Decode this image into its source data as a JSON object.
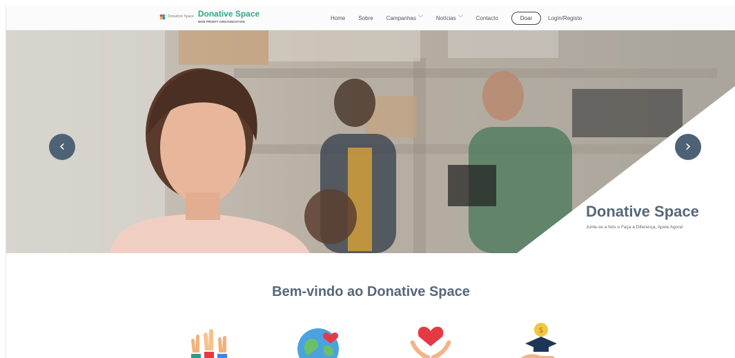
{
  "brand": {
    "small_text": "Donative Space",
    "title": "Donative Space",
    "subtitle": "NON PROFIT ORGANIZATION"
  },
  "nav": {
    "items": [
      {
        "label": "Home",
        "dropdown": false
      },
      {
        "label": "Sobre",
        "dropdown": false
      },
      {
        "label": "Campanhas",
        "dropdown": true
      },
      {
        "label": "Notícias",
        "dropdown": true
      },
      {
        "label": "Contacto",
        "dropdown": false
      }
    ],
    "donate_label": "Doar",
    "login_label": "Login/Registo"
  },
  "hero": {
    "title": "Donative Space",
    "subtitle": "Junte-se a Nós e Faça a Diferença, Apoie Agora!",
    "prev_icon": "‹",
    "next_icon": "›"
  },
  "welcome": {
    "heading": "Bem-vindo ao Donative Space"
  },
  "features": [
    {
      "icon": "raised-hands-icon"
    },
    {
      "icon": "globe-heart-icon"
    },
    {
      "icon": "heart-hands-icon"
    },
    {
      "icon": "graduation-coin-icon"
    }
  ],
  "colors": {
    "brand_green": "#2aa98a",
    "slate": "#56677a",
    "arrow_bg": "#4d6275"
  }
}
